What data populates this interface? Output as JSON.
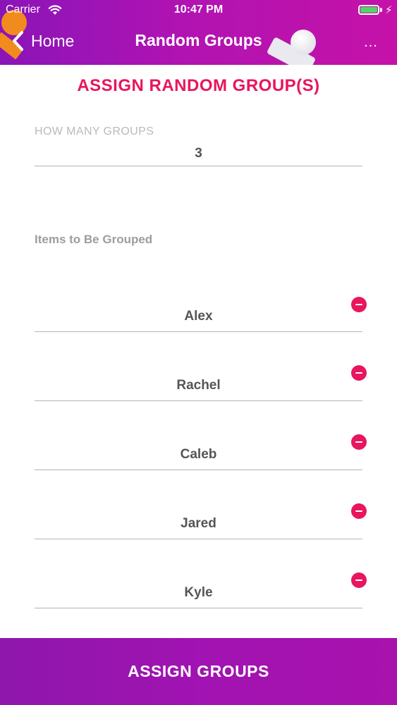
{
  "status_bar": {
    "carrier": "Carrier",
    "time": "10:47 PM"
  },
  "nav": {
    "back_label": "Home",
    "title": "Random Groups",
    "more_label": "..."
  },
  "content": {
    "heading": "ASSIGN RANDOM GROUP(S)",
    "groups_label": "HOW MANY GROUPS",
    "groups_value": "3",
    "items_label": "Items to Be Grouped",
    "items": [
      {
        "name": "Alex"
      },
      {
        "name": "Rachel"
      },
      {
        "name": "Caleb"
      },
      {
        "name": "Jared"
      },
      {
        "name": "Kyle"
      }
    ]
  },
  "footer": {
    "assign_label": "ASSIGN GROUPS"
  },
  "colors": {
    "accent": "#e8155f",
    "header_purple": "#a113b2",
    "battery_green": "#4cd964"
  },
  "icons": {
    "wifi": "wifi-icon",
    "battery": "battery-icon",
    "charging": "bolt-icon",
    "back": "back-chevron-icon",
    "remove": "remove-icon"
  }
}
